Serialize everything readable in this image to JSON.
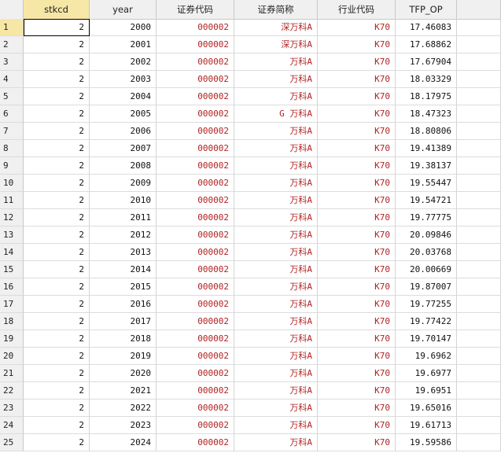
{
  "table": {
    "columns": [
      "stkcd",
      "year",
      "证券代码",
      "证券简称",
      "行业代码",
      "TFP_OP"
    ],
    "rows": [
      {
        "n": "1",
        "stkcd": "2",
        "year": "2000",
        "code": "000002",
        "name": "深万科A",
        "ind": "K70",
        "tfp": "17.46083"
      },
      {
        "n": "2",
        "stkcd": "2",
        "year": "2001",
        "code": "000002",
        "name": "深万科A",
        "ind": "K70",
        "tfp": "17.68862"
      },
      {
        "n": "3",
        "stkcd": "2",
        "year": "2002",
        "code": "000002",
        "name": "万科A",
        "ind": "K70",
        "tfp": "17.67904"
      },
      {
        "n": "4",
        "stkcd": "2",
        "year": "2003",
        "code": "000002",
        "name": "万科A",
        "ind": "K70",
        "tfp": "18.03329"
      },
      {
        "n": "5",
        "stkcd": "2",
        "year": "2004",
        "code": "000002",
        "name": "万科A",
        "ind": "K70",
        "tfp": "18.17975"
      },
      {
        "n": "6",
        "stkcd": "2",
        "year": "2005",
        "code": "000002",
        "name": "G 万科A",
        "ind": "K70",
        "tfp": "18.47323"
      },
      {
        "n": "7",
        "stkcd": "2",
        "year": "2006",
        "code": "000002",
        "name": "万科A",
        "ind": "K70",
        "tfp": "18.80806"
      },
      {
        "n": "8",
        "stkcd": "2",
        "year": "2007",
        "code": "000002",
        "name": "万科A",
        "ind": "K70",
        "tfp": "19.41389"
      },
      {
        "n": "9",
        "stkcd": "2",
        "year": "2008",
        "code": "000002",
        "name": "万科A",
        "ind": "K70",
        "tfp": "19.38137"
      },
      {
        "n": "10",
        "stkcd": "2",
        "year": "2009",
        "code": "000002",
        "name": "万科A",
        "ind": "K70",
        "tfp": "19.55447"
      },
      {
        "n": "11",
        "stkcd": "2",
        "year": "2010",
        "code": "000002",
        "name": "万科A",
        "ind": "K70",
        "tfp": "19.54721"
      },
      {
        "n": "12",
        "stkcd": "2",
        "year": "2011",
        "code": "000002",
        "name": "万科A",
        "ind": "K70",
        "tfp": "19.77775"
      },
      {
        "n": "13",
        "stkcd": "2",
        "year": "2012",
        "code": "000002",
        "name": "万科A",
        "ind": "K70",
        "tfp": "20.09846"
      },
      {
        "n": "14",
        "stkcd": "2",
        "year": "2013",
        "code": "000002",
        "name": "万科A",
        "ind": "K70",
        "tfp": "20.03768"
      },
      {
        "n": "15",
        "stkcd": "2",
        "year": "2014",
        "code": "000002",
        "name": "万科A",
        "ind": "K70",
        "tfp": "20.00669"
      },
      {
        "n": "16",
        "stkcd": "2",
        "year": "2015",
        "code": "000002",
        "name": "万科A",
        "ind": "K70",
        "tfp": "19.87007"
      },
      {
        "n": "17",
        "stkcd": "2",
        "year": "2016",
        "code": "000002",
        "name": "万科A",
        "ind": "K70",
        "tfp": "19.77255"
      },
      {
        "n": "18",
        "stkcd": "2",
        "year": "2017",
        "code": "000002",
        "name": "万科A",
        "ind": "K70",
        "tfp": "19.77422"
      },
      {
        "n": "19",
        "stkcd": "2",
        "year": "2018",
        "code": "000002",
        "name": "万科A",
        "ind": "K70",
        "tfp": "19.70147"
      },
      {
        "n": "20",
        "stkcd": "2",
        "year": "2019",
        "code": "000002",
        "name": "万科A",
        "ind": "K70",
        "tfp": "19.6962"
      },
      {
        "n": "21",
        "stkcd": "2",
        "year": "2020",
        "code": "000002",
        "name": "万科A",
        "ind": "K70",
        "tfp": "19.6977"
      },
      {
        "n": "22",
        "stkcd": "2",
        "year": "2021",
        "code": "000002",
        "name": "万科A",
        "ind": "K70",
        "tfp": "19.6951"
      },
      {
        "n": "23",
        "stkcd": "2",
        "year": "2022",
        "code": "000002",
        "name": "万科A",
        "ind": "K70",
        "tfp": "19.65016"
      },
      {
        "n": "24",
        "stkcd": "2",
        "year": "2023",
        "code": "000002",
        "name": "万科A",
        "ind": "K70",
        "tfp": "19.61713"
      },
      {
        "n": "25",
        "stkcd": "2",
        "year": "2024",
        "code": "000002",
        "name": "万科A",
        "ind": "K70",
        "tfp": "19.59586"
      }
    ]
  },
  "colors": {
    "header_bg": "#f0f0f0",
    "selected_header_bg": "#f6e7a6",
    "string_text": "#b22222",
    "numeric_text": "#111111",
    "gridline": "#dcdcdc"
  }
}
